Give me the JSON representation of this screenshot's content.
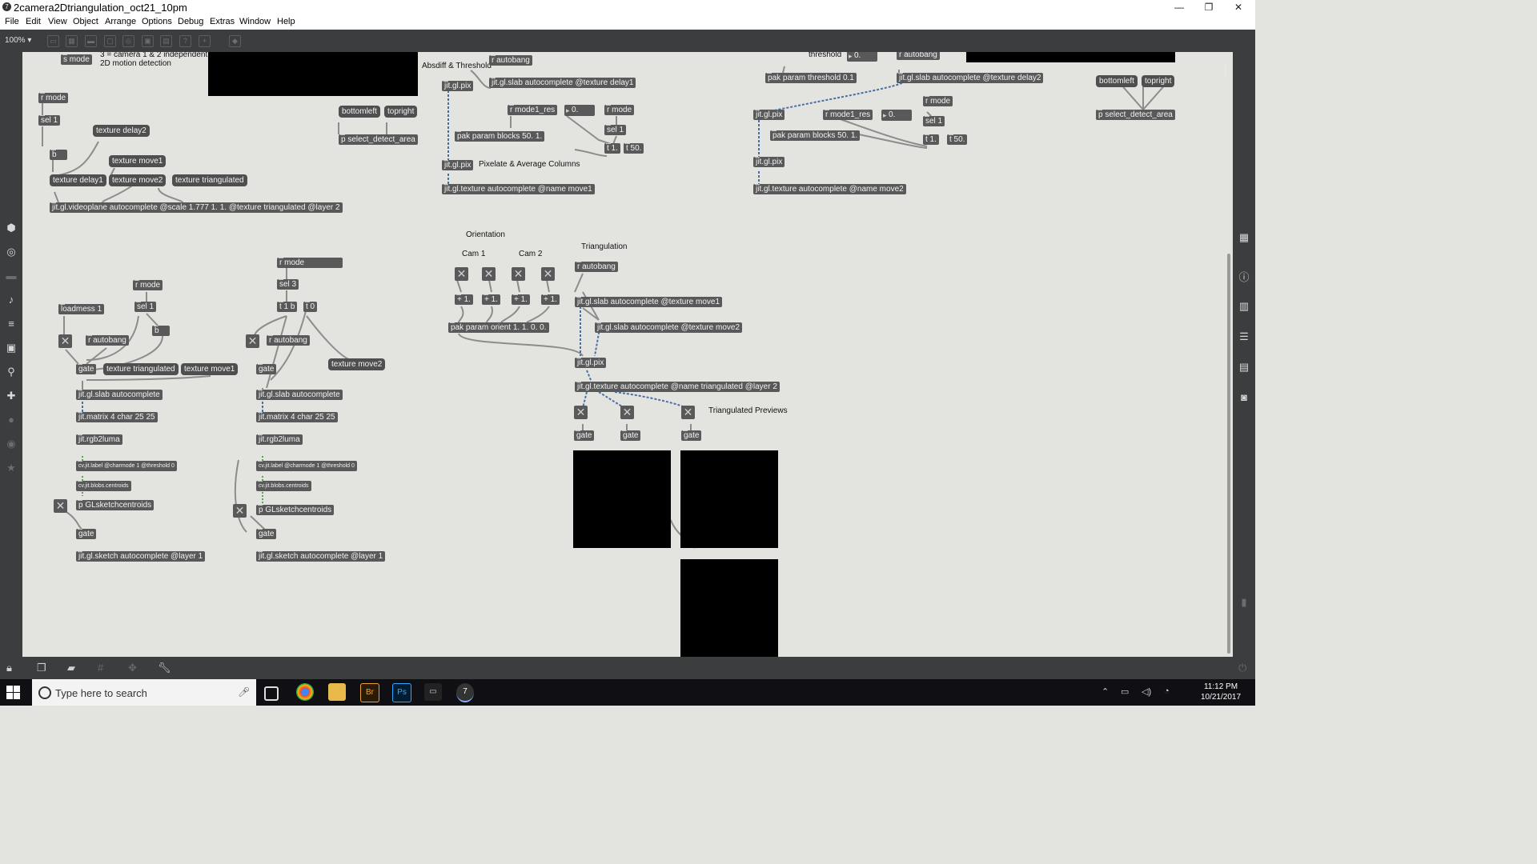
{
  "window": {
    "title": "2camera2Dtriangulation_oct21_10pm",
    "app_icon": "max-icon",
    "minimize": "—",
    "restore": "❐",
    "close": "✕"
  },
  "menu": [
    "File",
    "Edit",
    "View",
    "Object",
    "Arrange",
    "Options",
    "Debug",
    "Extras",
    "Window",
    "Help"
  ],
  "toolbar": {
    "zoom": "100% ▾"
  },
  "comments": {
    "mode_desc_1": "3 = camera 1 & 2 independent",
    "mode_desc_2": "2D motion detection",
    "absdiff": "Absdiff & Threshold",
    "threshold": "threshold",
    "pixelate": "Pixelate & Average Columns",
    "orientation": "Orientation",
    "cam1": "Cam 1",
    "cam2": "Cam 2",
    "triangulation": "Triangulation",
    "triangulated_previews": "Triangulated Previews"
  },
  "objects": {
    "s_mode": "s mode",
    "r_mode_a": "r mode",
    "sel1_a": "sel 1",
    "b_a": "b",
    "msg_texture_delay2": "texture delay2",
    "msg_texture_move1_a": "texture move1",
    "msg_texture_delay1": "texture delay1",
    "msg_texture_move2_a": "texture move2",
    "msg_texture_triangulated_a": "texture triangulated",
    "videoplane": "jit.gl.videoplane autocomplete @scale 1.777 1. 1. @texture triangulated @layer 2",
    "msg_bottomleft_a": "bottomleft",
    "msg_topright_a": "topright",
    "select_detect_a": "p select_detect_area",
    "r_autobang_a": "r autobang",
    "glpix_a": "jit.gl.pix",
    "slab_delay1": "jit.gl.slab autocomplete @texture delay1",
    "r_mode1_res_a": "r mode1_res",
    "num_a": "0.",
    "r_mode_b": "r mode",
    "sel1_b": "sel 1",
    "pak_blocks_a": "pak param blocks 50. 1.",
    "t1_a": "t 1.",
    "t50_a": "t 50.",
    "glpix_b": "jit.gl.pix",
    "texture_move1": "jit.gl.texture autocomplete @name move1",
    "num_thresh": "0.",
    "r_autobang_b": "r autobang",
    "pak_threshold": "pak param threshold 0.1",
    "slab_delay2": "jit.gl.slab autocomplete @texture delay2",
    "glpix_c": "jit.gl.pix",
    "r_mode1_res_b": "r mode1_res",
    "num_b": "0.",
    "r_mode_c": "r mode",
    "sel1_c": "sel 1",
    "pak_blocks_b": "pak param blocks 50. 1.",
    "t1_b": "t 1.",
    "t50_b": "t 50.",
    "glpix_d": "jit.gl.pix",
    "texture_move2": "jit.gl.texture autocomplete @name move2",
    "msg_bottomleft_b": "bottomleft",
    "msg_topright_b": "topright",
    "select_detect_b": "p select_detect_area",
    "r_mode_d": "r mode",
    "sel1_d": "sel 1",
    "b_d": "b",
    "loadmess": "loadmess 1",
    "r_autobang_c": "r autobang",
    "gate_1": "gate",
    "msg_texture_triangulated_b": "texture triangulated",
    "msg_texture_move1_b": "texture move1",
    "slab_1": "jit.gl.slab autocomplete",
    "matrix_1": "jit.matrix 4 char 25 25",
    "rgb2luma_1": "jit.rgb2luma",
    "cvlabel_1": "cv.jit.label @charmode 1 @threshold 0",
    "blobs_1": "cv.jit.blobs.centroids",
    "sketchcentroids_1": "p GLsketchcentroids",
    "gate_2": "gate",
    "sketch_1": "jit.gl.sketch autocomplete @layer 1",
    "r_mode_e": "r mode",
    "sel3": "sel 3",
    "t1b": "t 1 b",
    "t0": "t 0",
    "r_autobang_d": "r autobang",
    "msg_texture_move2_b": "texture move2",
    "gate_3": "gate",
    "slab_2": "jit.gl.slab autocomplete",
    "matrix_2": "jit.matrix 4 char 25 25",
    "rgb2luma_2": "jit.rgb2luma",
    "cvlabel_2": "cv.jit.label @charmode 1 @threshold 0",
    "blobs_2": "cv.jit.blobs.centroids",
    "sketchcentroids_2": "p GLsketchcentroids",
    "gate_4": "gate",
    "sketch_2": "jit.gl.sketch autocomplete @layer 1",
    "plus_1": "+ 1.",
    "plus_2": "+ 1.",
    "plus_3": "+ 1.",
    "plus_4": "+ 1.",
    "pak_orient": "pak param orient 1. 1. 0. 0.",
    "r_autobang_e": "r autobang",
    "slab_move1": "jit.gl.slab autocomplete @texture move1",
    "slab_move2": "jit.gl.slab autocomplete @texture move2",
    "glpix_e": "jit.gl.pix",
    "texture_triangulated": "jit.gl.texture autocomplete @name triangulated @layer 2",
    "gate_5": "gate",
    "gate_6": "gate",
    "gate_7": "gate"
  },
  "toggle_glyph": "✕",
  "taskbar": {
    "search_placeholder": "Type here to search",
    "time": "11:12 PM",
    "date": "10/21/2017",
    "apps": [
      "Br",
      "Ps",
      "▭",
      "7"
    ]
  },
  "colors": {
    "canvas_bg": "#e3e3e0",
    "chrome_bg": "#3c3d3e",
    "object_bg": "#595959",
    "patch_cord": "#8c8c8c",
    "signal_cord": "#4a6fa5"
  }
}
